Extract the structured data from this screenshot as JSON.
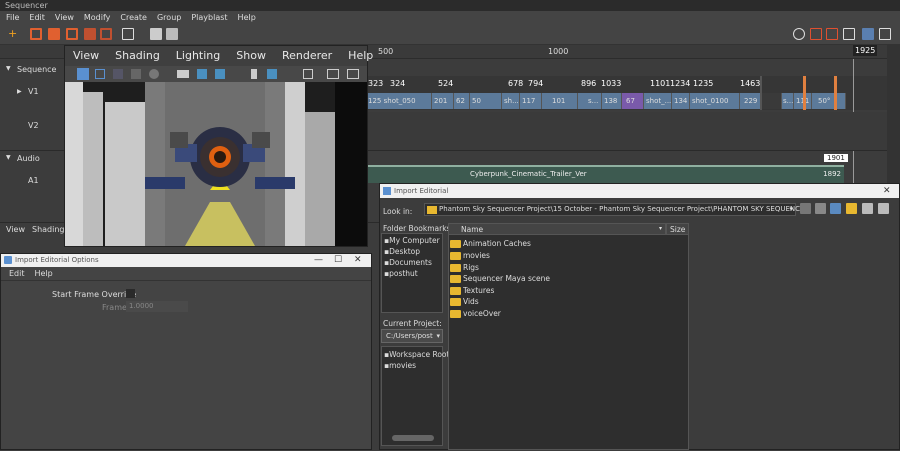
{
  "window_title": "Sequencer",
  "menu": [
    "File",
    "Edit",
    "View",
    "Modify",
    "Create",
    "Group",
    "Playblast",
    "Help"
  ],
  "ruler": {
    "mark_500": "500",
    "mark_1000": "1000",
    "end_frame": "1925"
  },
  "tracks": {
    "sequence": "Sequence",
    "v1": "V1",
    "v2": "V2",
    "audio": "Audio",
    "a1": "A1"
  },
  "clip_numbers": [
    "323",
    "324",
    "524",
    "678",
    "794",
    "896",
    "1033",
    "1101",
    "1234",
    "1235",
    "1463"
  ],
  "clips": [
    {
      "num": "125",
      "name": "shot_050",
      "end": "201"
    },
    {
      "num": "62",
      "name": "50"
    },
    {
      "num": "sh...",
      "name": "117"
    },
    {
      "num": "101",
      "name": "s..."
    },
    {
      "num": "138",
      "name": "67"
    },
    {
      "num": "shot_...",
      "name": "134"
    },
    {
      "num": "shot_0100",
      "name": "229"
    },
    {
      "num": "s...",
      "name": "111"
    },
    {
      "num": "50°",
      "name": ""
    }
  ],
  "audio": {
    "label": "Cyberpunk_Cinematic_Trailer_Ver",
    "frame_top": "1901",
    "frame_bottom": "1892"
  },
  "viewport": {
    "menus": [
      "View",
      "Shading",
      "Lighting",
      "Show",
      "Renderer",
      "Help"
    ],
    "lower_menus": [
      "View",
      "Shading"
    ]
  },
  "editorial_options": {
    "title": "Import Editorial Options",
    "menu": [
      "Edit",
      "Help"
    ],
    "start_frame_label": "Start Frame Override",
    "frame_label": "Frame",
    "frame_value": "1.0000"
  },
  "import_editorial": {
    "title": "Import Editorial",
    "look_in_label": "Look in:",
    "look_in_path": "Phantom Sky Sequencer Project\\15 October - Phantom Sky Sequencer Project\\PHANTOM SKY SEQUENCER",
    "bookmarks_label": "Folder Bookmarks:",
    "bookmarks": [
      "My Computer",
      "Desktop",
      "Documents",
      "posthut"
    ],
    "current_project_label": "Current Project:",
    "current_project_value": "C:/Users/post",
    "project_items": [
      "Workspace Root",
      "movies"
    ],
    "col_name": "Name",
    "col_size": "Size",
    "files": [
      "Animation Caches",
      "movies",
      "Rigs",
      "Sequencer Maya scene",
      "Textures",
      "Vids",
      "voiceOver"
    ]
  }
}
